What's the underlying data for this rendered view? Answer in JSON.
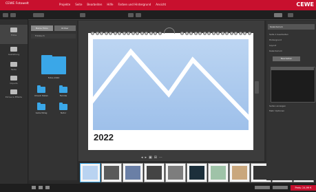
{
  "colors": {
    "brand": "#c8102e",
    "folder": "#3aa7e8",
    "sky": "#b3cff0"
  },
  "header": {
    "app_name": "CEWE Fotowelt",
    "menu": [
      "Projekte",
      "Seite",
      "Bearbeiten",
      "Hilfe",
      "Farben und Hintergrund",
      "Ansicht"
    ],
    "logo": "CEWE"
  },
  "left_rail": {
    "items": [
      {
        "label": "Fotos",
        "icon": "photo-icon"
      },
      {
        "label": "Gestaltung",
        "icon": "layout-icon"
      },
      {
        "label": "Texte",
        "icon": "text-icon"
      },
      {
        "label": "Cliparts",
        "icon": "clipart-icon"
      },
      {
        "label": "Extras & Effekte",
        "icon": "effects-icon"
      }
    ]
  },
  "left_panel": {
    "tabs": [
      "Meine Fotos",
      "Ordner"
    ],
    "breadcrumb": "Fotobuch",
    "main_folder": "Fotos 2022",
    "folders": [
      "Urlaub Italien",
      "Familie",
      "Geburtstag",
      "Natur"
    ]
  },
  "canvas": {
    "year": "2022"
  },
  "filmstrip": {
    "count": 11,
    "selected": 0
  },
  "right_panel": {
    "title": "Kalendarium",
    "rows": [
      "Seite 1 bearbeiten",
      "Hintergrund",
      "Layout",
      "Kalendarium"
    ],
    "button": "Bearbeiten",
    "footer": [
      "Seiten anzeigen",
      "Mehr Optionen"
    ]
  },
  "status": {
    "price": "Preis: 24,99 €"
  }
}
